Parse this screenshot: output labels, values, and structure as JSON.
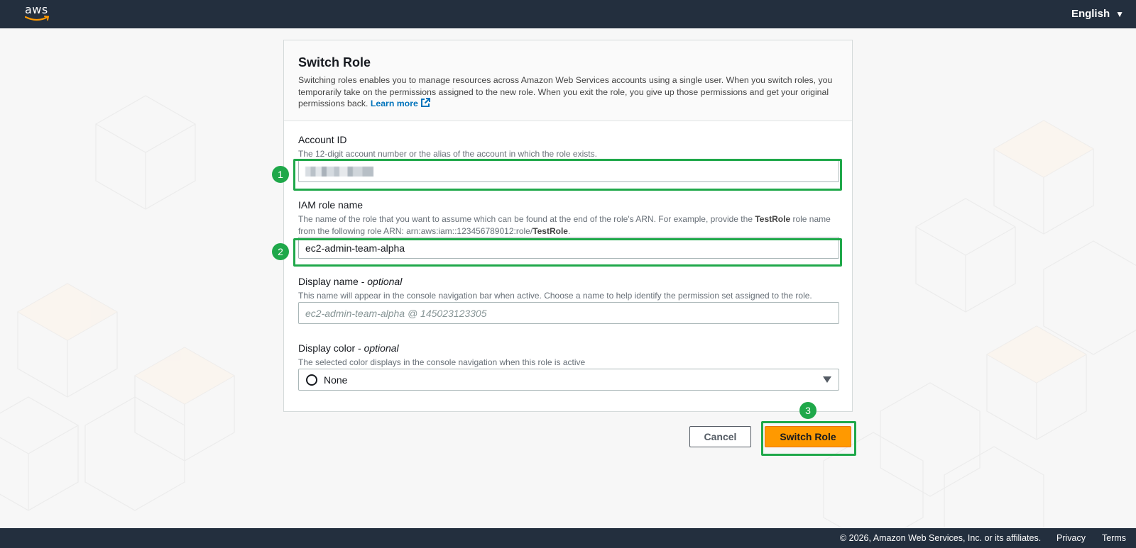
{
  "nav": {
    "logo_text": "aws",
    "language": "English",
    "language_caret": "▼"
  },
  "card": {
    "title": "Switch Role",
    "description": "Switching roles enables you to manage resources across Amazon Web Services accounts using a single user. When you switch roles, you temporarily take on the permissions assigned to the new role. When you exit the role, you give up those permissions and get your original permissions back.",
    "learn_more": "Learn more"
  },
  "fields": {
    "account_id": {
      "label": "Account ID",
      "hint": "The 12-digit account number or the alias of the account in which the role exists.",
      "value": ""
    },
    "role_name": {
      "label": "IAM role name",
      "hint_prefix": "The name of the role that you want to assume which can be found at the end of the role's ARN. For example, provide the ",
      "hint_bold1": "TestRole",
      "hint_mid": " role name from the following role ARN: arn:aws:iam::123456789012:role/",
      "hint_bold2": "TestRole",
      "hint_suffix": ".",
      "value": "ec2-admin-team-alpha"
    },
    "display_name": {
      "label": "Display name - ",
      "label_optional": "optional",
      "hint": "This name will appear in the console navigation bar when active. Choose a name to help identify the permission set assigned to the role.",
      "placeholder": "ec2-admin-team-alpha @ 145023123305"
    },
    "display_color": {
      "label": "Display color - ",
      "label_optional": "optional",
      "hint": "The selected color displays in the console navigation when this role is active",
      "selected": "None"
    }
  },
  "buttons": {
    "cancel": "Cancel",
    "switch_role": "Switch Role"
  },
  "annotations": {
    "badge1": "1",
    "badge2": "2",
    "badge3": "3",
    "color": "#1fa84a"
  },
  "footer": {
    "copyright": "© 2026, Amazon Web Services, Inc. or its affiliates.",
    "privacy": "Privacy",
    "terms": "Terms"
  },
  "colors": {
    "nav_bg": "#232f3e",
    "primary": "#ff9900",
    "link": "#0073bb"
  }
}
